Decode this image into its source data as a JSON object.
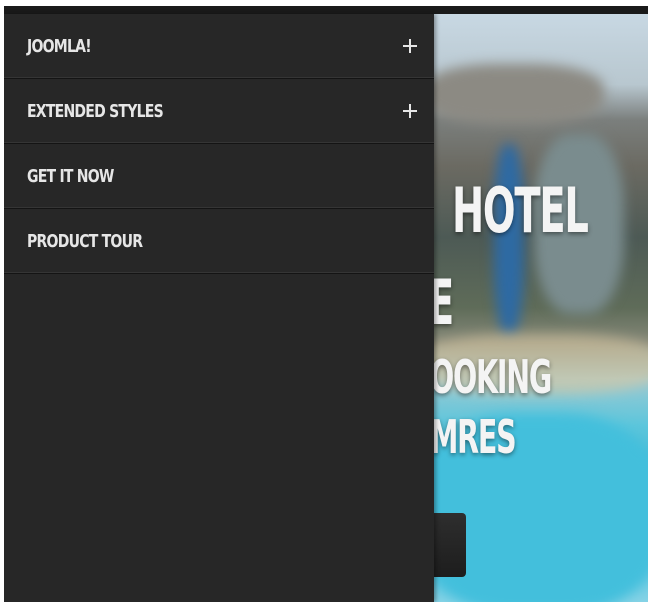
{
  "menu": {
    "items": [
      {
        "label": "JOOMLA!",
        "has_submenu": true,
        "icon": "plus-icon"
      },
      {
        "label": "EXTENDED STYLES",
        "has_submenu": true,
        "icon": "plus-icon"
      },
      {
        "label": "GET IT NOW",
        "has_submenu": false
      },
      {
        "label": "PRODUCT TOUR",
        "has_submenu": false
      }
    ]
  },
  "hero": {
    "line1": "HOTEL",
    "line2": "E",
    "line3": "OOKING",
    "line4": "MRES"
  },
  "colors": {
    "menu_bg": "#272727",
    "menu_text": "#e6e6e6",
    "divider": "#141414"
  }
}
